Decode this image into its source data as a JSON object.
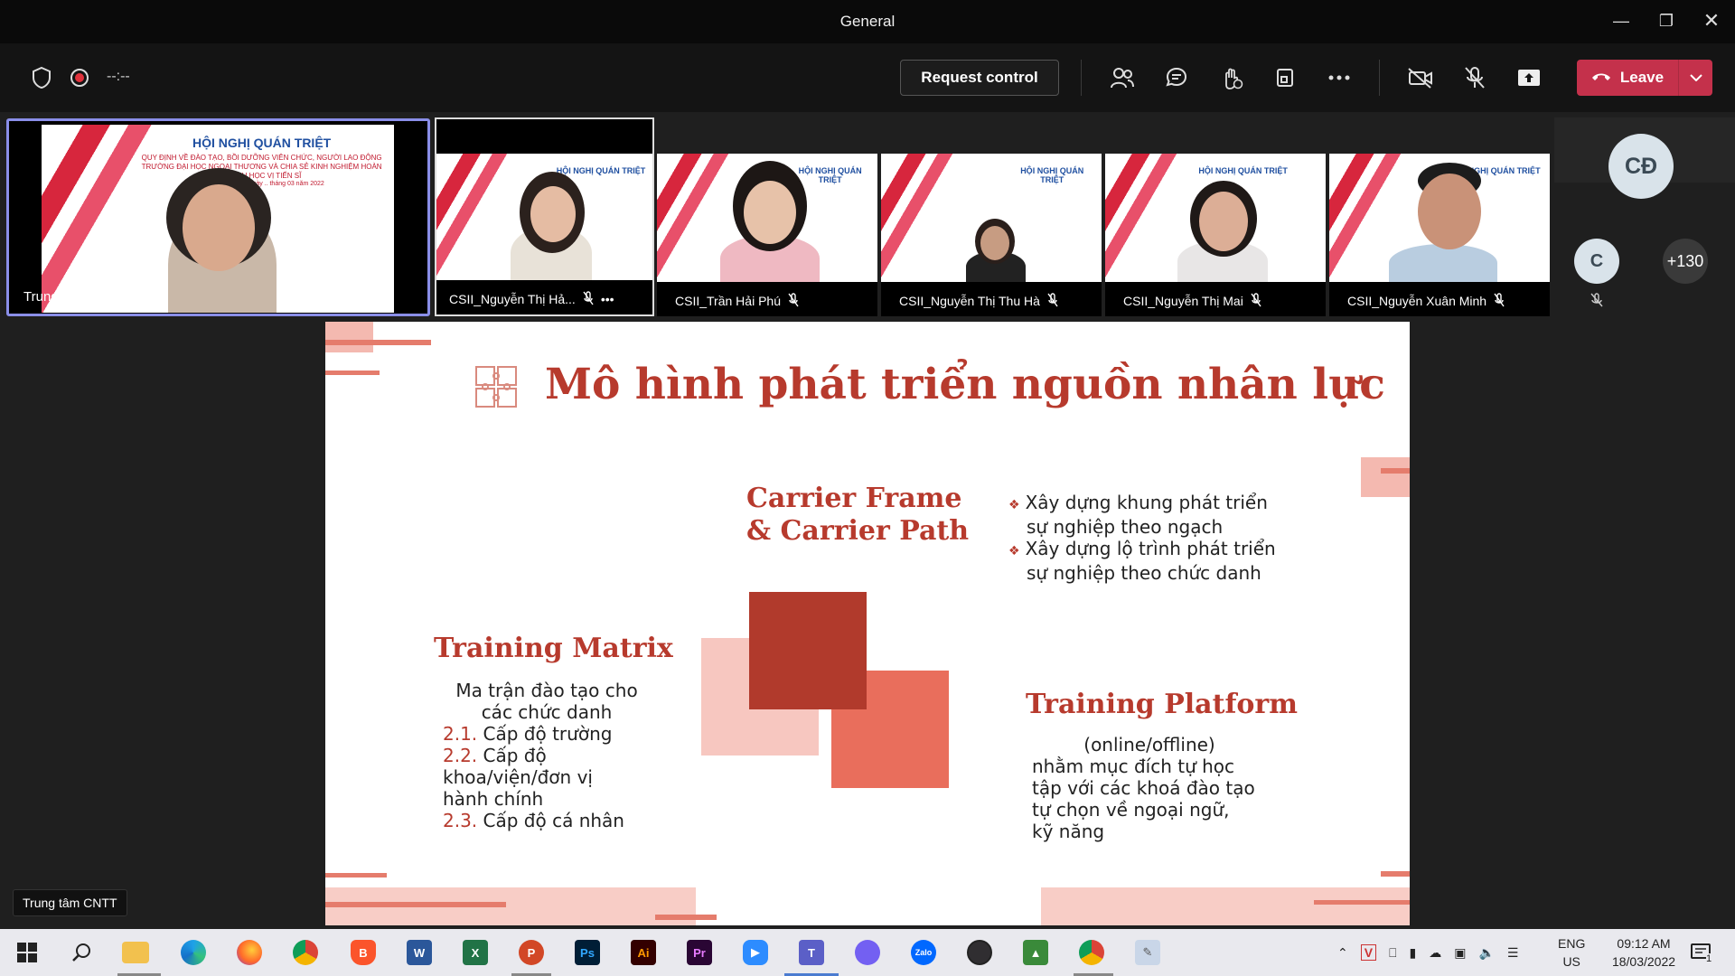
{
  "window": {
    "title": "General"
  },
  "toolbar": {
    "timer": "--:--",
    "request_control_label": "Request control",
    "leave_label": "Leave"
  },
  "featured": {
    "name": "Trung tâm CNTT"
  },
  "participants": [
    {
      "name": "CSII_Nguyễn Thị Hả..."
    },
    {
      "name": "CSII_Trần Hải Phú"
    },
    {
      "name": "CSII_Nguyễn Thị Thu Hà"
    },
    {
      "name": "CSII_Nguyễn Thị Mai"
    },
    {
      "name": "CSII_Nguyễn Xuân Minh"
    }
  ],
  "thumb_slide": {
    "heading": "HỘI NGHỊ QUÁN TRIỆT",
    "sub": "QUY ĐỊNH VỀ ĐÀO TẠO, BỒI DƯỠNG VIÊN CHỨC, NGƯỜI LAO ĐỘNG TRƯỜNG ĐẠI HỌC NGOẠI THƯƠNG VÀ CHIA SẺ KINH NGHIỆM HOÀN THÀNH HỌC VỊ TIẾN SĨ",
    "place": "TP. HCM, ngày .. tháng 03 năm 2022"
  },
  "side_avatars": {
    "initials_large": "CĐ",
    "initials_small": "C",
    "overflow_count": "+130"
  },
  "slide": {
    "title": "Mô hình phát triển nguồn nhân lực",
    "carrier_heading_1": "Carrier Frame",
    "carrier_heading_2": "& Carrier Path",
    "carrier_bullets": [
      {
        "line1": "Xây dựng khung phát triển",
        "line2": "sự nghiệp theo ngạch"
      },
      {
        "line1": "Xây dựng lộ trình phát triển",
        "line2": "sự nghiệp theo chức danh"
      }
    ],
    "training_matrix_heading": "Training Matrix",
    "training_matrix_intro_1": "Ma trận đào tạo cho",
    "training_matrix_intro_2": "các chức danh",
    "training_matrix_items": [
      {
        "num": "2.1.",
        "text": "Cấp độ trường"
      },
      {
        "num": "2.2.",
        "text": "Cấp độ"
      },
      {
        "num": "",
        "text": "khoa/viện/đơn vị"
      },
      {
        "num": "",
        "text": "hành chính"
      },
      {
        "num": "2.3.",
        "text": "Cấp độ cá nhân"
      }
    ],
    "training_platform_heading": "Training Platform",
    "training_platform_lines": [
      "(online/offline)",
      "nhằm mục đích tự học",
      "tập với các khoá đào tạo",
      "tự chọn về ngoại ngữ,",
      "kỹ năng"
    ]
  },
  "presenter_tooltip": "Trung tâm CNTT",
  "taskbar": {
    "lang_1": "ENG",
    "lang_2": "US",
    "time": "09:12 AM",
    "date": "18/03/2022",
    "notification_count": "1"
  },
  "colors": {
    "accent_red": "#b73a2d",
    "leave_red": "#c4314b",
    "spotlight_border": "#8a8ee8"
  }
}
